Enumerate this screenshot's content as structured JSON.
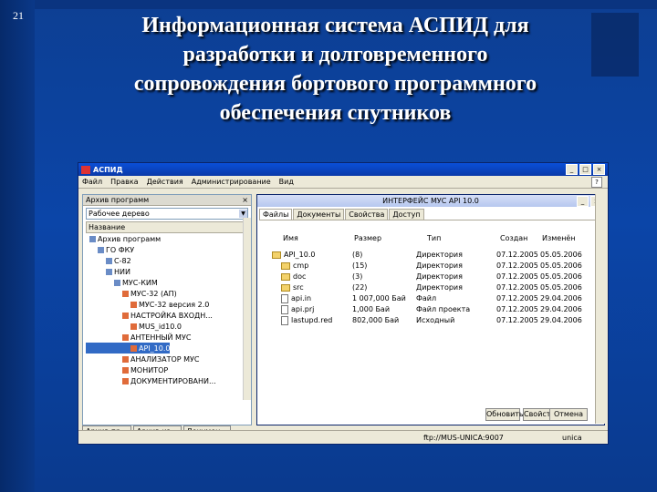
{
  "slide": {
    "number": "21",
    "title_lines": [
      "Информационная система АСПИД для",
      "разработки и долговременного",
      "сопровождения бортового программного",
      "обеспечения спутников"
    ]
  },
  "window": {
    "title": "АСПИД",
    "controls": [
      "_",
      "□",
      "×"
    ],
    "menu": [
      "Файл",
      "Правка",
      "Действия",
      "Администрирование",
      "Вид"
    ],
    "help": "?"
  },
  "left_pane": {
    "header": "Архив программ",
    "view_combo": "Рабочее дерево",
    "column": "Название",
    "tree": [
      {
        "label": "Архив программ",
        "level": 0,
        "expanded": true
      },
      {
        "label": "ГО ФКУ",
        "level": 1,
        "expanded": true
      },
      {
        "label": "С-82",
        "level": 2,
        "expanded": false
      },
      {
        "label": "НИИ",
        "level": 2,
        "expanded": true
      },
      {
        "label": "МУС-КИМ",
        "level": 3,
        "expanded": true
      },
      {
        "label": "МУС-32 (АП)",
        "level": 4,
        "expanded": true
      },
      {
        "label": "МУС-32 версия 2.0",
        "level": 5
      },
      {
        "label": "НАСТРОЙКА ВХОДН...",
        "level": 4
      },
      {
        "label": "MUS_id10.0",
        "level": 5
      },
      {
        "label": "АНТЕННЫЙ МУС",
        "level": 4
      },
      {
        "label": "API_10.0",
        "level": 5,
        "selected": true
      },
      {
        "label": "АНАЛИЗАТОР МУС",
        "level": 4
      },
      {
        "label": "МОНИТОР",
        "level": 4
      },
      {
        "label": "ДОКУМЕНТИРОВАНИ...",
        "level": 4
      }
    ],
    "bottom_tabs": [
      "Архив пр...",
      "Архив из...",
      "Докумен..."
    ]
  },
  "child_window": {
    "title": "ИНТЕРФЕЙС МУС API 10.0",
    "tabs": [
      "Файлы",
      "Документы",
      "Свойства",
      "Доступ"
    ],
    "active_tab": "Файлы",
    "columns": [
      "Имя",
      "Размер",
      "Тип",
      "Создан",
      "Изменён"
    ],
    "rows": [
      {
        "name": "API_10.0",
        "size": "(8)",
        "type": "Директория",
        "created": "07.12.2005",
        "modified": "05.05.2006",
        "icon": "folder",
        "indent": 0
      },
      {
        "name": "cmp",
        "size": "(15)",
        "type": "Директория",
        "created": "07.12.2005",
        "modified": "05.05.2006",
        "icon": "folder",
        "indent": 1
      },
      {
        "name": "doc",
        "size": "(3)",
        "type": "Директория",
        "created": "07.12.2005",
        "modified": "05.05.2006",
        "icon": "folder",
        "indent": 1
      },
      {
        "name": "src",
        "size": "(22)",
        "type": "Директория",
        "created": "07.12.2005",
        "modified": "05.05.2006",
        "icon": "folder",
        "indent": 1
      },
      {
        "name": "api.in",
        "size": "1 007,000 Бай",
        "type": "Файл",
        "created": "07.12.2005",
        "modified": "29.04.2006",
        "icon": "file",
        "indent": 1
      },
      {
        "name": "api.prj",
        "size": "1,000 Бай",
        "type": "Файл проекта",
        "created": "07.12.2005",
        "modified": "29.04.2006",
        "icon": "file",
        "indent": 1
      },
      {
        "name": "lastupd.red",
        "size": "802,000 Бай",
        "type": "Исходный",
        "created": "07.12.2005",
        "modified": "29.04.2006",
        "icon": "file",
        "indent": 1
      }
    ],
    "buttons": [
      "Обновить",
      "Свойства"
    ],
    "close": "Отмена"
  },
  "statusbar": {
    "path": "ftp://MUS-UNICA:9007",
    "user": "unica"
  }
}
